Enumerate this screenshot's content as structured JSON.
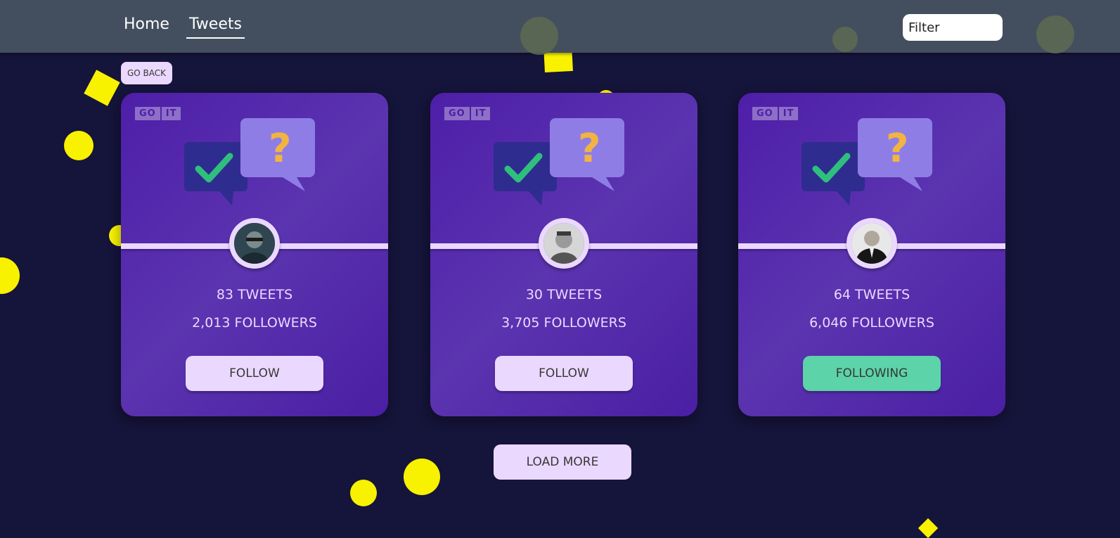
{
  "header": {
    "nav": [
      {
        "label": "Home",
        "active": false
      },
      {
        "label": "Tweets",
        "active": true
      }
    ],
    "filter": {
      "placeholder": "Filter",
      "value": ""
    }
  },
  "go_back_label": "GO BACK",
  "cards": [
    {
      "logo_go": "GO",
      "logo_it": "IT",
      "tweets": "83 TWEETS",
      "followers": "2,013 FOLLOWERS",
      "button": "FOLLOW",
      "following": false
    },
    {
      "logo_go": "GO",
      "logo_it": "IT",
      "tweets": "30 TWEETS",
      "followers": "3,705 FOLLOWERS",
      "button": "FOLLOW",
      "following": false
    },
    {
      "logo_go": "GO",
      "logo_it": "IT",
      "tweets": "64 TWEETS",
      "followers": "6,046 FOLLOWERS",
      "button": "FOLLOWING",
      "following": true
    }
  ],
  "load_more_label": "LOAD MORE",
  "colors": {
    "background": "#15143a",
    "header": "#434f5e",
    "card": "#5b34b0",
    "button": "#ebd8ff",
    "following": "#5cd3a8",
    "confetti": "#f8f100"
  }
}
